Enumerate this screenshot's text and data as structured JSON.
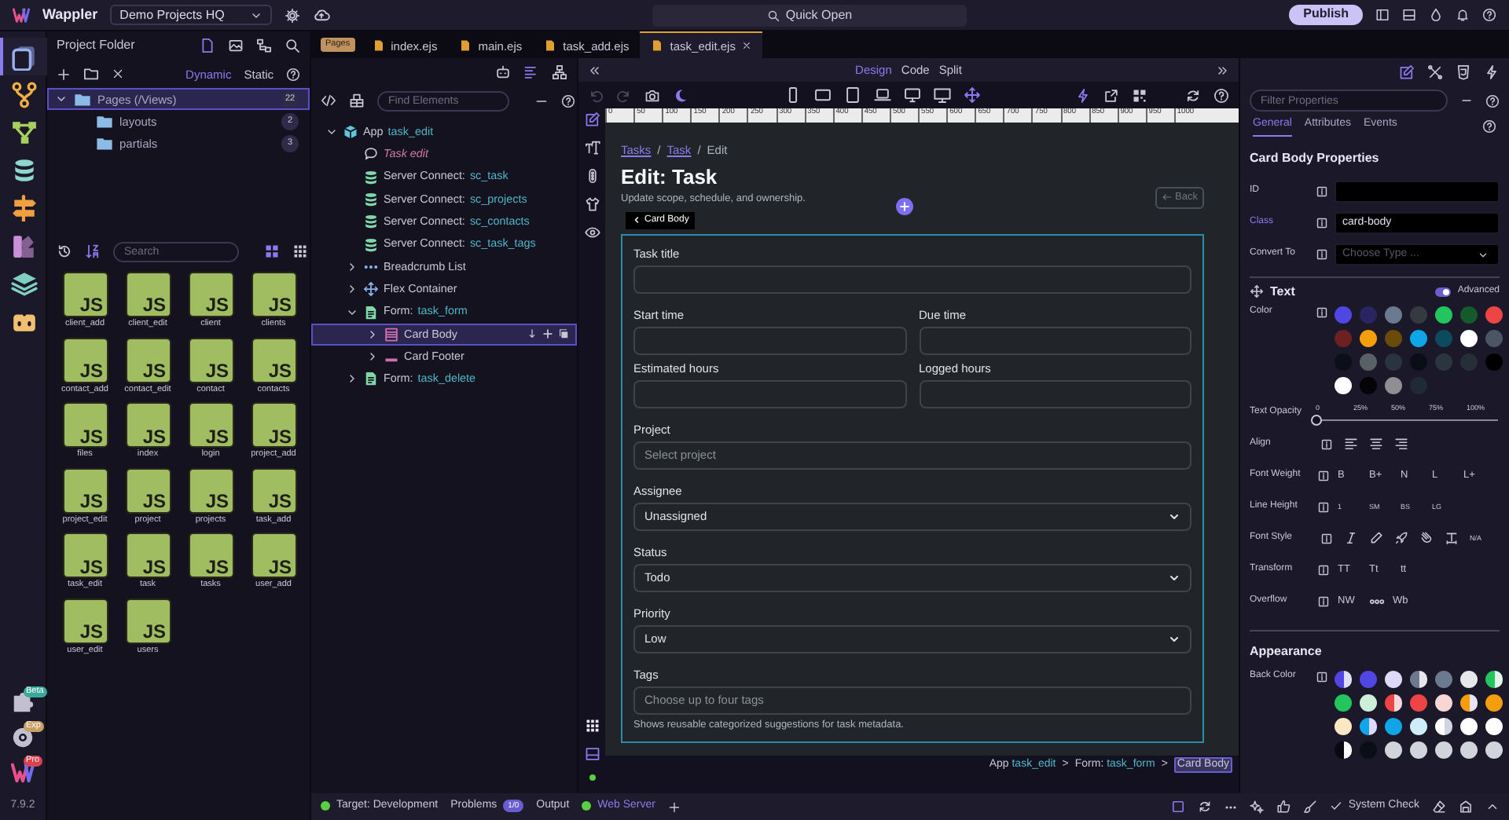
{
  "app_bar": {
    "app_name": "Wappler",
    "project": "Demo Projects HQ",
    "quick_open": "Quick Open",
    "publish": "Publish"
  },
  "side_rail": {
    "items": [
      {
        "kind": "pages",
        "selected": true
      },
      {
        "kind": "git",
        "selected": false
      },
      {
        "kind": "flows",
        "selected": false
      },
      {
        "kind": "database",
        "selected": false
      },
      {
        "kind": "routing",
        "selected": false
      },
      {
        "kind": "design",
        "selected": false
      },
      {
        "kind": "layers",
        "selected": false
      },
      {
        "kind": "ai",
        "selected": false
      }
    ],
    "tools": [
      {
        "kind": "extensions",
        "badge": "Beta",
        "color": "#3aa89a"
      },
      {
        "kind": "settings",
        "badge": "Exp",
        "color": "#c8a066"
      },
      {
        "kind": "account",
        "badge": "Pro",
        "color": "#d9434f"
      }
    ],
    "version": "7.9.2"
  },
  "project_panel": {
    "title": "Project Folder",
    "modes": [
      {
        "label": "Dynamic",
        "selected": true
      },
      {
        "label": "Static",
        "selected": false
      }
    ],
    "tree": [
      {
        "label": "Pages (/Views)",
        "count": "22",
        "expanded": true,
        "selected": true,
        "children": [
          {
            "label": "layouts",
            "count": "2",
            "selected": false
          },
          {
            "label": "partials",
            "count": "3",
            "selected": false
          }
        ]
      }
    ],
    "search": {
      "placeholder": "Search"
    },
    "files": [
      {
        "name": "client_add",
        "type": "JS"
      },
      {
        "name": "client_edit",
        "type": "JS"
      },
      {
        "name": "client",
        "type": "JS"
      },
      {
        "name": "clients",
        "type": "JS"
      },
      {
        "name": "contact_add",
        "type": "JS"
      },
      {
        "name": "contact_edit",
        "type": "JS"
      },
      {
        "name": "contact",
        "type": "JS"
      },
      {
        "name": "contacts",
        "type": "JS"
      },
      {
        "name": "files",
        "type": "JS"
      },
      {
        "name": "index",
        "type": "JS"
      },
      {
        "name": "login",
        "type": "JS"
      },
      {
        "name": "project_add",
        "type": "JS"
      },
      {
        "name": "project_edit",
        "type": "JS"
      },
      {
        "name": "project",
        "type": "JS"
      },
      {
        "name": "projects",
        "type": "JS"
      },
      {
        "name": "task_add",
        "type": "JS"
      },
      {
        "name": "task_edit",
        "type": "JS"
      },
      {
        "name": "task",
        "type": "JS"
      },
      {
        "name": "tasks",
        "type": "JS"
      },
      {
        "name": "user_add",
        "type": "JS"
      },
      {
        "name": "user_edit",
        "type": "JS"
      },
      {
        "name": "users",
        "type": "JS"
      }
    ]
  },
  "editor_tabs": {
    "badge": "Pages",
    "tabs": [
      {
        "label": "index.ejs",
        "selected": false
      },
      {
        "label": "main.ejs",
        "selected": false
      },
      {
        "label": "task_add.ejs",
        "selected": false
      },
      {
        "label": "task_edit.ejs",
        "selected": true
      }
    ]
  },
  "structure": {
    "find": {
      "placeholder": "Find Elements"
    },
    "tree": [
      {
        "kind": "app",
        "label": "App",
        "ref": "task_edit",
        "expanded": true,
        "selected": false,
        "children": [
          {
            "kind": "comment",
            "label": "Task edit",
            "selected": false
          },
          {
            "kind": "server_connect",
            "label": "Server Connect:",
            "ref": "sc_task",
            "selected": false
          },
          {
            "kind": "server_connect",
            "label": "Server Connect:",
            "ref": "sc_projects",
            "selected": false
          },
          {
            "kind": "server_connect",
            "label": "Server Connect:",
            "ref": "sc_contacts",
            "selected": false
          },
          {
            "kind": "server_connect",
            "label": "Server Connect:",
            "ref": "sc_task_tags",
            "selected": false
          },
          {
            "kind": "breadcrumb",
            "label": "Breadcrumb List",
            "expanded": false,
            "selected": false
          },
          {
            "kind": "flex",
            "label": "Flex Container",
            "expanded": false,
            "selected": false
          },
          {
            "kind": "form",
            "label": "Form:",
            "ref": "task_form",
            "expanded": true,
            "selected": false,
            "children": [
              {
                "kind": "card_body",
                "label": "Card Body",
                "expanded": false,
                "selected": true
              },
              {
                "kind": "card_footer",
                "label": "Card Footer",
                "expanded": false,
                "selected": false
              }
            ]
          },
          {
            "kind": "form",
            "label": "Form:",
            "ref": "task_delete",
            "expanded": false,
            "selected": false
          }
        ]
      }
    ]
  },
  "design": {
    "views": [
      {
        "label": "Design",
        "selected": true
      },
      {
        "label": "Code",
        "selected": false
      },
      {
        "label": "Split",
        "selected": false
      }
    ],
    "ruler": [
      "0",
      "50",
      "100",
      "150",
      "200",
      "250",
      "300",
      "350",
      "400",
      "450",
      "500",
      "550",
      "600",
      "650",
      "700",
      "750",
      "800",
      "850",
      "900",
      "950",
      "1000"
    ],
    "page": {
      "breadcrumb": [
        {
          "label": "Tasks",
          "link": true
        },
        {
          "sep": "/",
          "label": "Task",
          "link": true
        },
        {
          "sep": "/",
          "label": "Edit",
          "link": false
        }
      ],
      "title": "Edit: Task",
      "subtitle": "Update scope, schedule, and ownership.",
      "back": "Back",
      "selection_tag": "Card Body",
      "rows": [
        {
          "fields": [
            {
              "kind": "text",
              "label": "Task title"
            }
          ]
        },
        {
          "fields": [
            {
              "kind": "text",
              "label": "Start time"
            },
            {
              "kind": "text",
              "label": "Due time"
            }
          ]
        },
        {
          "fields": [
            {
              "kind": "text",
              "label": "Estimated hours"
            },
            {
              "kind": "text",
              "label": "Logged hours"
            }
          ]
        },
        {
          "fields": [
            {
              "kind": "text",
              "label": "Project",
              "placeholder": "Select project"
            }
          ]
        },
        {
          "fields": [
            {
              "kind": "select",
              "label": "Assignee",
              "value": "Unassigned"
            }
          ]
        },
        {
          "fields": [
            {
              "kind": "select",
              "label": "Status",
              "value": "Todo"
            }
          ]
        },
        {
          "fields": [
            {
              "kind": "select",
              "label": "Priority",
              "value": "Low"
            }
          ]
        },
        {
          "fields": [
            {
              "kind": "text",
              "label": "Tags",
              "placeholder": "Choose up to four tags"
            }
          ]
        }
      ],
      "help": "Shows reusable categorized suggestions for task metadata."
    },
    "path": [
      {
        "label": "App",
        "ref": "task_edit",
        "selected": false
      },
      {
        "sep": ">",
        "label": "Form:",
        "ref": "task_form",
        "selected": false
      },
      {
        "sep": ">",
        "label": "Card Body",
        "selected": true
      }
    ]
  },
  "properties": {
    "filter": {
      "placeholder": "Filter Properties"
    },
    "tabs": [
      {
        "label": "General",
        "selected": true
      },
      {
        "label": "Attributes",
        "selected": false
      },
      {
        "label": "Events",
        "selected": false
      }
    ],
    "heading": "Card Body Properties",
    "fields": [
      {
        "kind": "text",
        "label": "ID",
        "set": false
      },
      {
        "kind": "text",
        "label": "Class",
        "value": "card-body",
        "set": true
      },
      {
        "kind": "select",
        "label": "Convert To",
        "placeholder": "Choose Type ...",
        "set": false
      }
    ],
    "text": {
      "title": "Text",
      "advanced": {
        "label": "Advanced",
        "on": true
      },
      "color": {
        "label": "Color",
        "swatches": [
          {
            "color": "#5046e4"
          },
          {
            "color": "#2a2560"
          },
          {
            "color": "#6b7a8f"
          },
          {
            "color": "#343a40"
          },
          {
            "color": "#22c55e"
          },
          {
            "color": "#145a2c"
          },
          {
            "color": "#ef4444"
          },
          {
            "color": "#6e2020"
          },
          {
            "color": "#f59e0b"
          },
          {
            "color": "#6b4a0a"
          },
          {
            "color": "#0ea5e9"
          },
          {
            "color": "#0c4a5e"
          },
          {
            "color": "#ffffff"
          },
          {
            "color": "#4b5563"
          },
          {
            "color": "#0b1018"
          },
          {
            "color": "#5a6068"
          },
          {
            "color": "#2a3440"
          },
          {
            "color": "#0a0f17"
          },
          {
            "color": "#2c3440"
          },
          {
            "color": "#262f38"
          },
          {
            "color": "#000000"
          },
          {
            "color": "#ffffff"
          },
          {
            "color": "#050409"
          },
          {
            "color": "#8e8e93"
          },
          {
            "color": "#1f2a35"
          }
        ]
      },
      "opacity": {
        "label": "Text Opacity",
        "ticks": [
          "0",
          "25%",
          "50%",
          "75%",
          "100%"
        ],
        "level": 0
      },
      "align": {
        "label": "Align"
      },
      "font_weight": {
        "label": "Font Weight",
        "options": [
          "B",
          "B+",
          "N",
          "L",
          "L+"
        ]
      },
      "line_height": {
        "label": "Line Height",
        "options": [
          "1",
          "SM",
          "BS",
          "LG"
        ]
      },
      "font_style": {
        "label": "Font Style",
        "none": "N/A"
      },
      "transform": {
        "label": "Transform",
        "options": [
          "TT",
          "Tt",
          "tt"
        ]
      },
      "overflow": {
        "label": "Overflow",
        "options": [
          {
            "kind": "text",
            "label": "NW"
          },
          {
            "kind": "icon"
          },
          {
            "kind": "text",
            "label": "Wb"
          }
        ]
      }
    },
    "appearance": {
      "title": "Appearance",
      "back_color": {
        "label": "Back Color",
        "swatches": [
          {
            "color": "#5046e4",
            "split": {
              "color": "#e0ddf8"
            }
          },
          {
            "color": "#5046e4"
          },
          {
            "color": "#ddd9f7"
          },
          {
            "color": "#6b7a8f",
            "split": {
              "color": "#e5e7eb"
            }
          },
          {
            "color": "#6b7a8f"
          },
          {
            "color": "#e5e7eb"
          },
          {
            "color": "#22c55e",
            "split": {
              "color": "#e2f5e8"
            }
          },
          {
            "color": "#22c55e"
          },
          {
            "color": "#cdeed8"
          },
          {
            "color": "#ef4444",
            "split": {
              "color": "#f3d9dd"
            }
          },
          {
            "color": "#ef4444"
          },
          {
            "color": "#f9d6d6"
          },
          {
            "color": "#f59e0b",
            "split": {
              "color": "#e9e4f5"
            }
          },
          {
            "color": "#f59e0b"
          },
          {
            "color": "#fbe7c4"
          },
          {
            "color": "#0ea5e9",
            "split": {
              "color": "#ddd9f7"
            }
          },
          {
            "color": "#0ea5e9"
          },
          {
            "color": "#cdeef8"
          },
          {
            "color": "#ffffff",
            "split": {
              "color": "#d0d4e0"
            }
          },
          {
            "color": "#ffffff"
          },
          {
            "color": "#ffffff"
          },
          {
            "color": "#0a0912",
            "split": {
              "color": "#ffffff"
            }
          },
          {
            "color": "#0a0f17"
          },
          {
            "color": "#d1d5db"
          },
          {
            "color": "#d1d5db"
          },
          {
            "color": "#d1d5db"
          },
          {
            "color": "#d1d5db"
          },
          {
            "color": "#d1d5db"
          }
        ]
      }
    }
  },
  "status_bar": {
    "target": "Target: Development",
    "problems": "Problems",
    "problem_count": "1/0",
    "output": "Output",
    "web_server": "Web Server",
    "system_check": "System Check"
  }
}
